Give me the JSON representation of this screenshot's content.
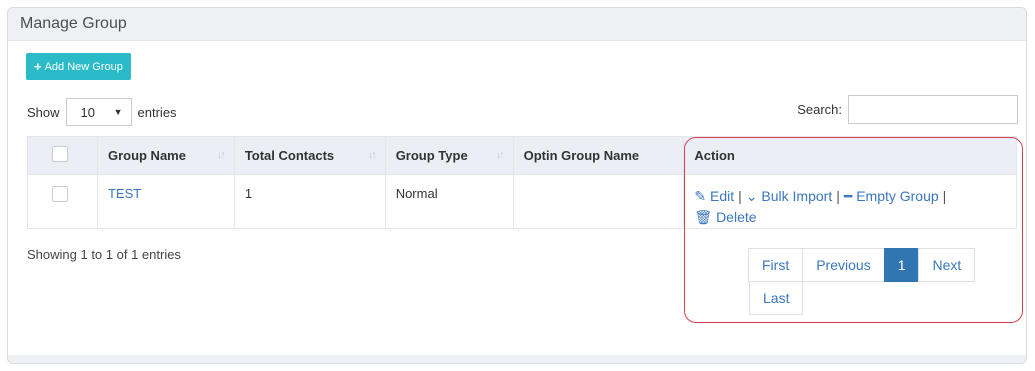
{
  "panel": {
    "title": "Manage Group"
  },
  "toolbar": {
    "add_label": "Add New Group",
    "add_icon": "plus-icon"
  },
  "length": {
    "show_label": "Show",
    "value": "10",
    "entries_label": "entries"
  },
  "search": {
    "label": "Search:",
    "value": ""
  },
  "table": {
    "headers": [
      "Group Name",
      "Total Contacts",
      "Group Type",
      "Optin Group Name",
      "Action"
    ],
    "rows": [
      {
        "group_name": "TEST",
        "total_contacts": "1",
        "group_type": "Normal",
        "optin_group_name": ""
      }
    ],
    "actions": {
      "edit": "Edit",
      "bulk_import": "Bulk Import",
      "empty_group": "Empty Group",
      "delete": "Delete",
      "separator": "|"
    }
  },
  "info": "Showing 1 to 1 of 1 entries",
  "pagination": {
    "first": "First",
    "previous": "Previous",
    "current": "1",
    "next": "Next",
    "last": "Last"
  },
  "colors": {
    "accent": "#2bbbc8",
    "link": "#3a77c0",
    "active_page": "#3276b1",
    "highlight": "#d9404e"
  }
}
